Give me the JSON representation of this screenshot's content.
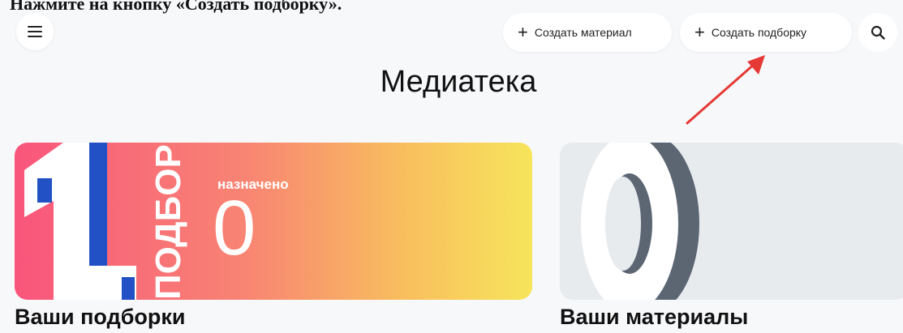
{
  "instruction": {
    "text": "Нажмите на кнопку «Создать подборку»."
  },
  "header": {
    "menu_icon": "hamburger-menu-icon",
    "create_material_label": "Создать материал",
    "create_selection_label": "Создать подборку",
    "plus_glyph": "+",
    "search_icon": "search-icon"
  },
  "page": {
    "title": "Медиатека"
  },
  "cards": {
    "selections": {
      "big_number": "1",
      "vertical_label": "ПОДБОРКА",
      "assigned_label": "назначено",
      "assigned_count": "0",
      "caption": "Ваши подборки",
      "gradient_colors": [
        "#f9557c",
        "#f88573",
        "#f8be5e",
        "#f7e55b"
      ]
    },
    "materials": {
      "big_number": "0",
      "caption": "Ваши материалы",
      "background": "#e8ebee"
    }
  },
  "colors": {
    "annotation_arrow": "#e53935",
    "accent_blue": "#2251c6",
    "zero_shadow": "#5c6673"
  }
}
